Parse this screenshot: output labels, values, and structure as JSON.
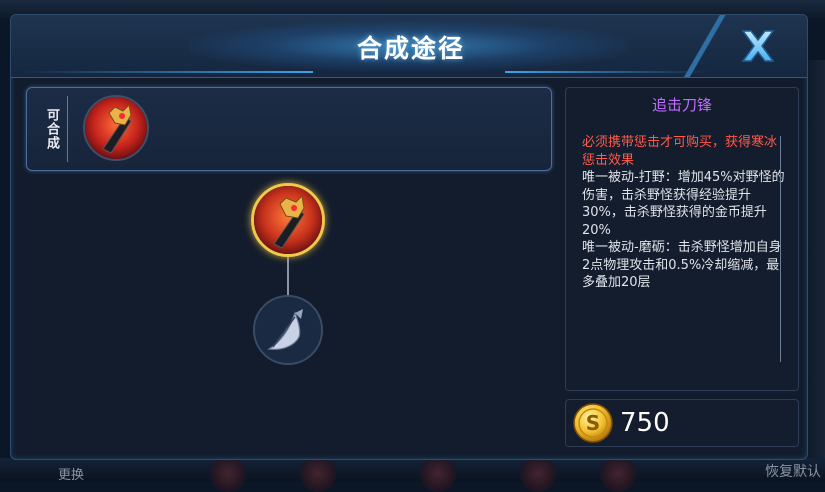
{
  "dialog": {
    "title": "合成途径",
    "close_icon": "close-x-icon"
  },
  "recipe": {
    "label": "可合成",
    "items": [
      {
        "icon": "chasing-blade-crimson-icon"
      }
    ]
  },
  "tree": {
    "root": {
      "icon": "chasing-blade-icon",
      "selected": true
    },
    "children": [
      {
        "icon": "hunting-blade-icon"
      }
    ]
  },
  "item": {
    "name": "追击刀锋",
    "requirement": "必须携带惩击才可购买，获得寒冰惩击效果",
    "passive1": "唯一被动-打野：增加45%对野怪的伤害，击杀野怪获得经验提升30%，击杀野怪获得的金币提升20%",
    "passive2": "唯一被动-磨砺：击杀野怪增加自身2点物理攻击和0.5%冷却缩减，最多叠加20层",
    "price": "750",
    "currency_icon": "gold-coin-icon"
  },
  "background": {
    "left_partial": "更换",
    "right_partial": "恢复默认"
  },
  "colors": {
    "item_name": "#c06bff",
    "requirement": "#ff5a4a",
    "selected_border": "#f1c94a",
    "accent": "#3aa4e8"
  }
}
